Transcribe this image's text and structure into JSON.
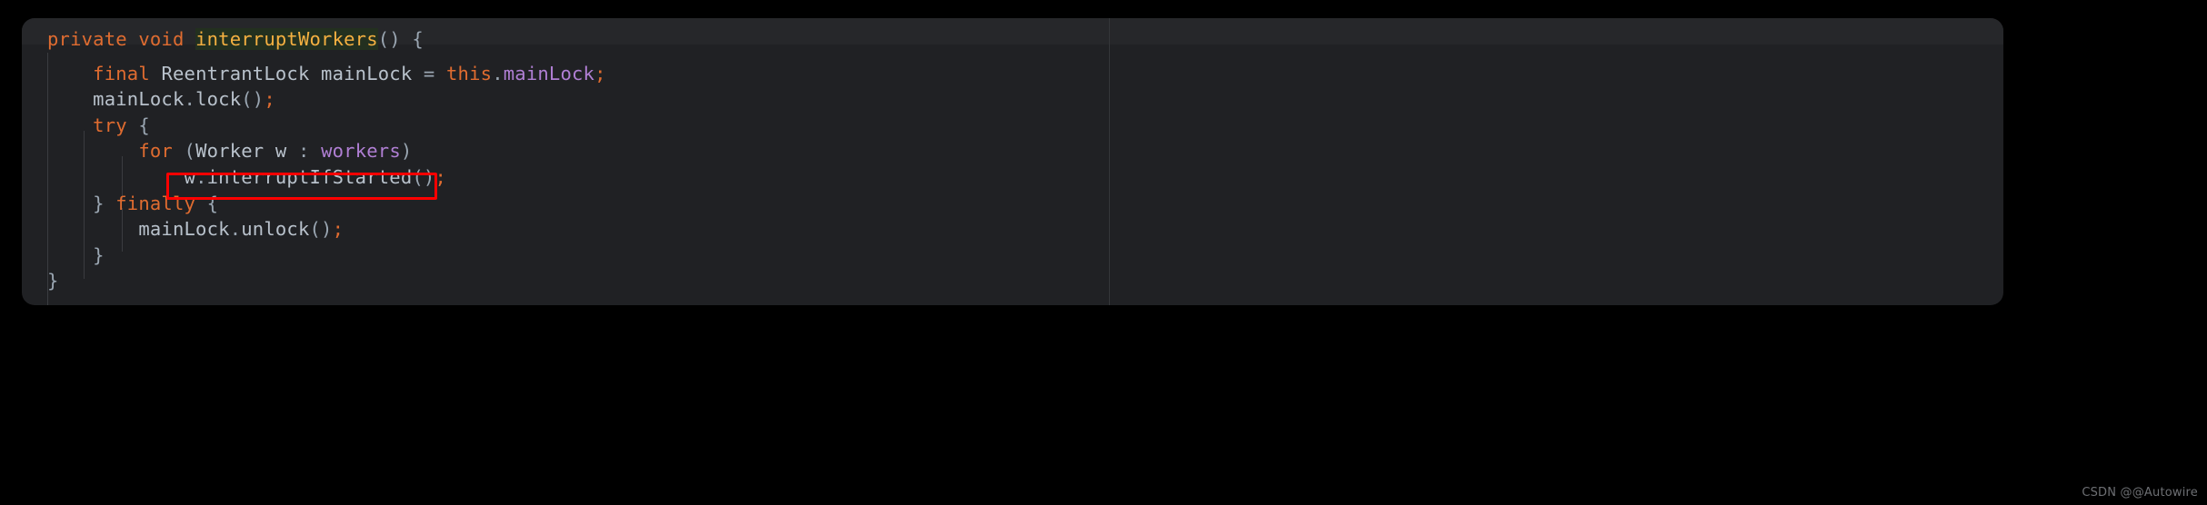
{
  "editor": {
    "language": "java",
    "theme_background": "#202124",
    "page_background": "#000000",
    "active_line_background": "#26272a",
    "occurrence_highlight": "#23301f",
    "colors": {
      "keyword": "#e06c30",
      "method_name": "#f5b041",
      "identifier": "#b9c2cc",
      "field": "#b07fd4",
      "punctuation": "#9aa6b2",
      "semicolon": "#e06c30",
      "annotation_red": "#ff0000",
      "ruler": "#343639",
      "indent_guide": "#3a3c40"
    },
    "lines": [
      {
        "indent": 0,
        "tokens": [
          {
            "text": "private",
            "type": "kw"
          },
          {
            "text": " ",
            "type": "plain"
          },
          {
            "text": "void",
            "type": "kw"
          },
          {
            "text": " ",
            "type": "plain"
          },
          {
            "text": "interruptWorkers",
            "type": "fn-hl"
          },
          {
            "text": "()",
            "type": "punc"
          },
          {
            "text": " ",
            "type": "plain"
          },
          {
            "text": "{",
            "type": "punc"
          }
        ]
      },
      {
        "indent": 1,
        "tokens": [
          {
            "text": "final",
            "type": "kw"
          },
          {
            "text": " ",
            "type": "plain"
          },
          {
            "text": "ReentrantLock",
            "type": "type"
          },
          {
            "text": " ",
            "type": "plain"
          },
          {
            "text": "mainLock",
            "type": "var"
          },
          {
            "text": " ",
            "type": "plain"
          },
          {
            "text": "=",
            "type": "punc"
          },
          {
            "text": " ",
            "type": "plain"
          },
          {
            "text": "this",
            "type": "kw"
          },
          {
            "text": ".",
            "type": "punc"
          },
          {
            "text": "mainLock",
            "type": "field"
          },
          {
            "text": ";",
            "type": "semi"
          }
        ]
      },
      {
        "indent": 1,
        "tokens": [
          {
            "text": "mainLock",
            "type": "var"
          },
          {
            "text": ".",
            "type": "punc"
          },
          {
            "text": "lock",
            "type": "var"
          },
          {
            "text": "()",
            "type": "punc"
          },
          {
            "text": ";",
            "type": "semi"
          }
        ]
      },
      {
        "indent": 1,
        "tokens": [
          {
            "text": "try",
            "type": "kw"
          },
          {
            "text": " ",
            "type": "plain"
          },
          {
            "text": "{",
            "type": "punc"
          }
        ]
      },
      {
        "indent": 2,
        "tokens": [
          {
            "text": "for",
            "type": "kw"
          },
          {
            "text": " ",
            "type": "plain"
          },
          {
            "text": "(",
            "type": "punc"
          },
          {
            "text": "Worker",
            "type": "type"
          },
          {
            "text": " ",
            "type": "plain"
          },
          {
            "text": "w",
            "type": "var"
          },
          {
            "text": " ",
            "type": "plain"
          },
          {
            "text": ":",
            "type": "punc"
          },
          {
            "text": " ",
            "type": "plain"
          },
          {
            "text": "workers",
            "type": "field"
          },
          {
            "text": ")",
            "type": "punc"
          }
        ]
      },
      {
        "indent": 3,
        "tokens": [
          {
            "text": "w",
            "type": "var"
          },
          {
            "text": ".",
            "type": "punc"
          },
          {
            "text": "interruptIfStarted",
            "type": "var"
          },
          {
            "text": "()",
            "type": "punc"
          },
          {
            "text": ";",
            "type": "semi"
          }
        ]
      },
      {
        "indent": 1,
        "tokens": [
          {
            "text": "}",
            "type": "punc"
          },
          {
            "text": " ",
            "type": "plain"
          },
          {
            "text": "finally",
            "type": "kw"
          },
          {
            "text": " ",
            "type": "plain"
          },
          {
            "text": "{",
            "type": "punc"
          }
        ]
      },
      {
        "indent": 2,
        "tokens": [
          {
            "text": "mainLock",
            "type": "var"
          },
          {
            "text": ".",
            "type": "punc"
          },
          {
            "text": "unlock",
            "type": "var"
          },
          {
            "text": "()",
            "type": "punc"
          },
          {
            "text": ";",
            "type": "semi"
          }
        ]
      },
      {
        "indent": 1,
        "tokens": [
          {
            "text": "}",
            "type": "punc"
          }
        ]
      },
      {
        "indent": 0,
        "tokens": [
          {
            "text": "}",
            "type": "punc"
          }
        ]
      }
    ],
    "annotation": {
      "shape": "rectangle",
      "color": "#ff0000",
      "targets_line_text": "w.interruptIfStarted();"
    }
  },
  "watermark": {
    "text": "CSDN @@Autowire"
  }
}
